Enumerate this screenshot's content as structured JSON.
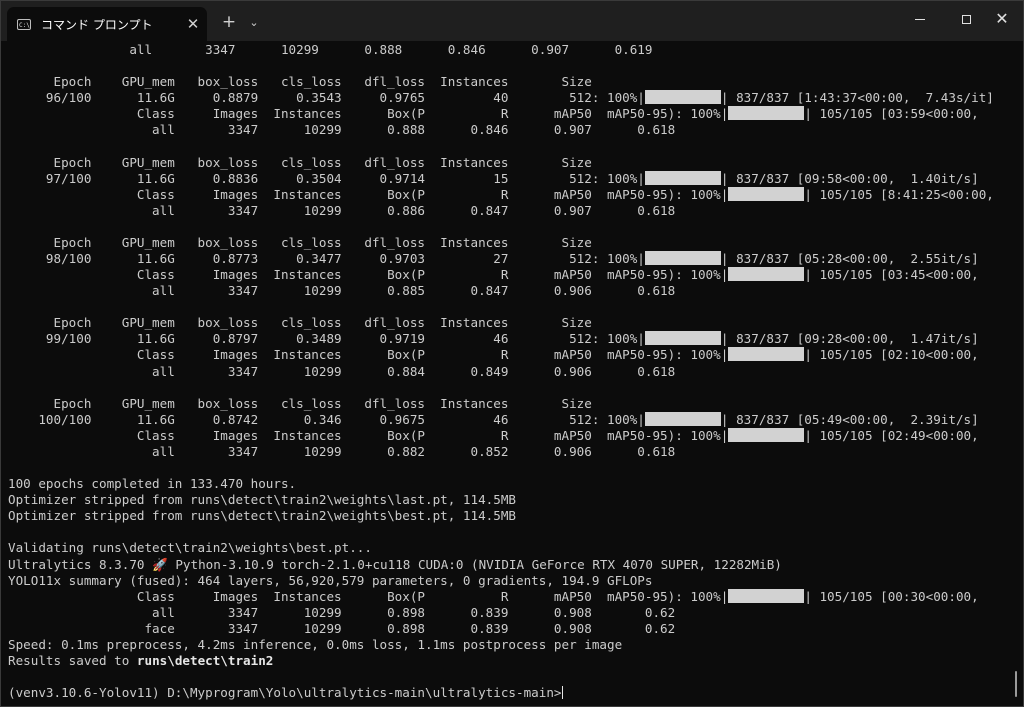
{
  "window": {
    "tab_title": "コマンド プロンプト",
    "tab_close_glyph": "✕",
    "new_tab_glyph": "+",
    "dropdown_glyph": "⌄",
    "close_glyph": "✕"
  },
  "terminal": {
    "lines": [
      {
        "segments": [
          {
            "text": "                all       3347      10299      0.888      0.846      0.907      0.619"
          }
        ]
      },
      {
        "segments": [
          {
            "text": ""
          }
        ]
      },
      {
        "segments": [
          {
            "text": "      Epoch    GPU_mem   box_loss   cls_loss   dfl_loss  Instances       Size"
          }
        ]
      },
      {
        "segments": [
          {
            "text": "     96/100      11.6G     0.8879     0.3543     0.9765         40        512: 100%|"
          },
          {
            "bar": true
          },
          {
            "text": "| 837/837 [1:43:37<00:00,  7.43s/it]"
          }
        ]
      },
      {
        "segments": [
          {
            "text": "                 Class     Images  Instances      Box(P          R      mAP50  mAP50-95): 100%|"
          },
          {
            "bar": true
          },
          {
            "text": "| 105/105 [03:59<00:00,"
          }
        ]
      },
      {
        "segments": [
          {
            "text": "                   all       3347      10299      0.888      0.846      0.907      0.618"
          }
        ]
      },
      {
        "segments": [
          {
            "text": ""
          }
        ]
      },
      {
        "segments": [
          {
            "text": "      Epoch    GPU_mem   box_loss   cls_loss   dfl_loss  Instances       Size"
          }
        ]
      },
      {
        "segments": [
          {
            "text": "     97/100      11.6G     0.8836     0.3504     0.9714         15        512: 100%|"
          },
          {
            "bar": true
          },
          {
            "text": "| 837/837 [09:58<00:00,  1.40it/s]"
          }
        ]
      },
      {
        "segments": [
          {
            "text": "                 Class     Images  Instances      Box(P          R      mAP50  mAP50-95): 100%|"
          },
          {
            "bar": true
          },
          {
            "text": "| 105/105 [8:41:25<00:00,"
          }
        ]
      },
      {
        "segments": [
          {
            "text": "                   all       3347      10299      0.886      0.847      0.907      0.618"
          }
        ]
      },
      {
        "segments": [
          {
            "text": ""
          }
        ]
      },
      {
        "segments": [
          {
            "text": "      Epoch    GPU_mem   box_loss   cls_loss   dfl_loss  Instances       Size"
          }
        ]
      },
      {
        "segments": [
          {
            "text": "     98/100      11.6G     0.8773     0.3477     0.9703         27        512: 100%|"
          },
          {
            "bar": true
          },
          {
            "text": "| 837/837 [05:28<00:00,  2.55it/s]"
          }
        ]
      },
      {
        "segments": [
          {
            "text": "                 Class     Images  Instances      Box(P          R      mAP50  mAP50-95): 100%|"
          },
          {
            "bar": true
          },
          {
            "text": "| 105/105 [03:45<00:00,"
          }
        ]
      },
      {
        "segments": [
          {
            "text": "                   all       3347      10299      0.885      0.847      0.906      0.618"
          }
        ]
      },
      {
        "segments": [
          {
            "text": ""
          }
        ]
      },
      {
        "segments": [
          {
            "text": "      Epoch    GPU_mem   box_loss   cls_loss   dfl_loss  Instances       Size"
          }
        ]
      },
      {
        "segments": [
          {
            "text": "     99/100      11.6G     0.8797     0.3489     0.9719         46        512: 100%|"
          },
          {
            "bar": true
          },
          {
            "text": "| 837/837 [09:28<00:00,  1.47it/s]"
          }
        ]
      },
      {
        "segments": [
          {
            "text": "                 Class     Images  Instances      Box(P          R      mAP50  mAP50-95): 100%|"
          },
          {
            "bar": true
          },
          {
            "text": "| 105/105 [02:10<00:00,"
          }
        ]
      },
      {
        "segments": [
          {
            "text": "                   all       3347      10299      0.884      0.849      0.906      0.618"
          }
        ]
      },
      {
        "segments": [
          {
            "text": ""
          }
        ]
      },
      {
        "segments": [
          {
            "text": "      Epoch    GPU_mem   box_loss   cls_loss   dfl_loss  Instances       Size"
          }
        ]
      },
      {
        "segments": [
          {
            "text": "    100/100      11.6G     0.8742      0.346     0.9675         46        512: 100%|"
          },
          {
            "bar": true
          },
          {
            "text": "| 837/837 [05:49<00:00,  2.39it/s]"
          }
        ]
      },
      {
        "segments": [
          {
            "text": "                 Class     Images  Instances      Box(P          R      mAP50  mAP50-95): 100%|"
          },
          {
            "bar": true
          },
          {
            "text": "| 105/105 [02:49<00:00,"
          }
        ]
      },
      {
        "segments": [
          {
            "text": "                   all       3347      10299      0.882      0.852      0.906      0.618"
          }
        ]
      },
      {
        "segments": [
          {
            "text": ""
          }
        ]
      },
      {
        "segments": [
          {
            "text": "100 epochs completed in 133.470 hours."
          }
        ]
      },
      {
        "segments": [
          {
            "text": "Optimizer stripped from runs\\detect\\train2\\weights\\last.pt, 114.5MB"
          }
        ]
      },
      {
        "segments": [
          {
            "text": "Optimizer stripped from runs\\detect\\train2\\weights\\best.pt, 114.5MB"
          }
        ]
      },
      {
        "segments": [
          {
            "text": ""
          }
        ]
      },
      {
        "segments": [
          {
            "text": "Validating runs\\detect\\train2\\weights\\best.pt..."
          }
        ]
      },
      {
        "segments": [
          {
            "text": "Ultralytics 8.3.70 🚀 Python-3.10.9 torch-2.1.0+cu118 CUDA:0 (NVIDIA GeForce RTX 4070 SUPER, 12282MiB)"
          }
        ]
      },
      {
        "segments": [
          {
            "text": "YOLO11x summary (fused): 464 layers, 56,920,579 parameters, 0 gradients, 194.9 GFLOPs"
          }
        ]
      },
      {
        "segments": [
          {
            "text": "                 Class     Images  Instances      Box(P          R      mAP50  mAP50-95): 100%|"
          },
          {
            "bar": true
          },
          {
            "text": "| 105/105 [00:30<00:00,"
          }
        ]
      },
      {
        "segments": [
          {
            "text": "                   all       3347      10299      0.898      0.839      0.908       0.62"
          }
        ]
      },
      {
        "segments": [
          {
            "text": "                  face       3347      10299      0.898      0.839      0.908       0.62"
          }
        ]
      },
      {
        "segments": [
          {
            "text": "Speed: 0.1ms preprocess, 4.2ms inference, 0.0ms loss, 1.1ms postprocess per image"
          }
        ]
      },
      {
        "segments": [
          {
            "text": "Results saved to "
          },
          {
            "text": "runs\\detect\\train2",
            "bold": true
          }
        ]
      },
      {
        "segments": [
          {
            "text": ""
          }
        ]
      },
      {
        "segments": [
          {
            "text": "(venv3.10.6-Yolov11) D:\\Myprogram\\Yolo\\ultralytics-main\\ultralytics-main>"
          },
          {
            "cursor": true
          }
        ]
      }
    ]
  }
}
